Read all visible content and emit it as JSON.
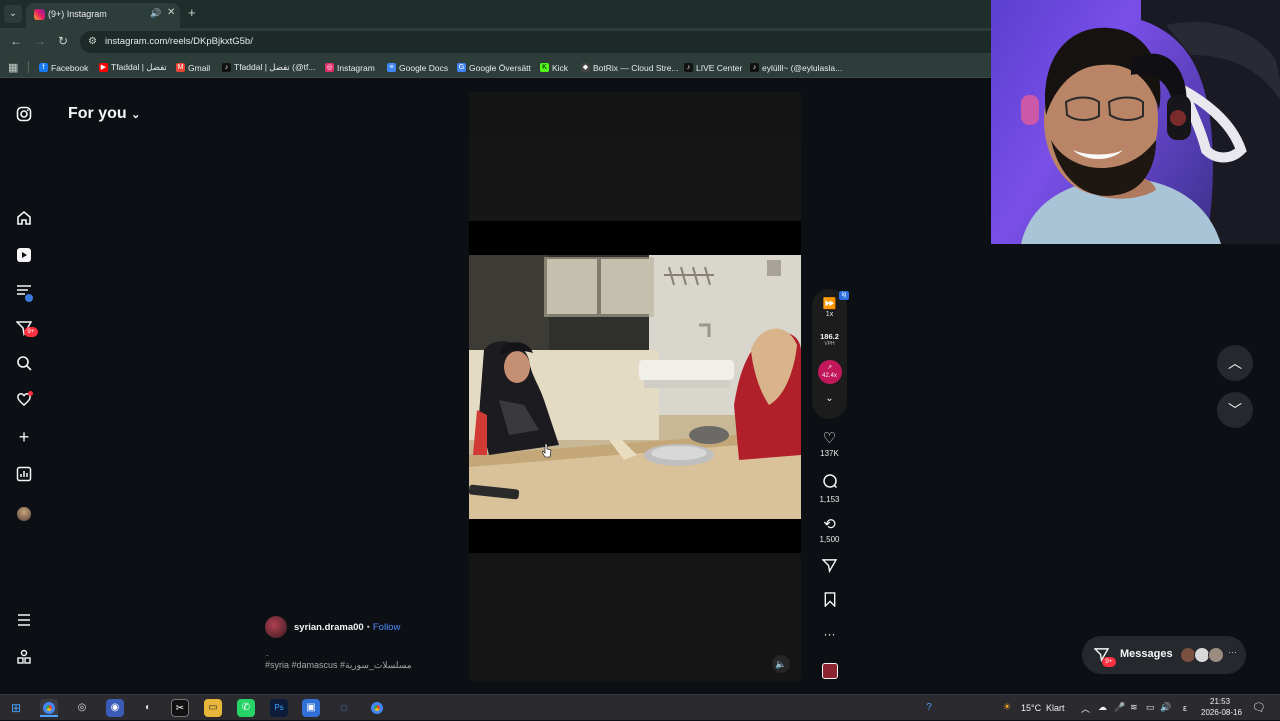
{
  "browser": {
    "tab_title": "(9+) Instagram",
    "url": "instagram.com/reels/DKpBjkxtG5b/",
    "bookmarks": [
      {
        "label": "Facebook",
        "color": "#1877f2",
        "glyph": "f"
      },
      {
        "label": "Tfaddal | تفضل",
        "color": "#ff0000",
        "glyph": "▶"
      },
      {
        "label": "Gmail",
        "color": "#ea4335",
        "glyph": "M"
      },
      {
        "label": "Tfaddal | تفضل (@tf...",
        "color": "#111111",
        "glyph": "♪"
      },
      {
        "label": "Instagram",
        "color": "#e1306c",
        "glyph": "◎"
      },
      {
        "label": "Google Docs",
        "color": "#4285f4",
        "glyph": "≡"
      },
      {
        "label": "Google Översätt",
        "color": "#4285f4",
        "glyph": "G"
      },
      {
        "label": "Kick",
        "color": "#53fc18",
        "glyph": "K"
      },
      {
        "label": "BotRix — Cloud Stre...",
        "color": "#444444",
        "glyph": "◆"
      },
      {
        "label": "LIVE Center",
        "color": "#111111",
        "glyph": "♪"
      },
      {
        "label": "eylülll~ (@eylulasla...",
        "color": "#111111",
        "glyph": "♪"
      }
    ]
  },
  "instagram": {
    "feed_title": "For you",
    "notifications_badge": "9+",
    "author": {
      "username": "syrian.drama00",
      "separator": "•",
      "follow_label": "Follow"
    },
    "caption_dot": ".",
    "caption": "#syria #damascus #مسلسلات_سورية",
    "extension": {
      "badge": "ig",
      "speed": "1x",
      "vph_value": "186.2",
      "vph_label": "VPH",
      "trend_value": "42.4x"
    },
    "actions": {
      "likes": "137K",
      "comments": "1,153",
      "reposts": "1,500"
    },
    "messages": {
      "label": "Messages",
      "badge": "9+"
    }
  },
  "taskbar": {
    "temperature": "15°C",
    "weather": "Klart",
    "language": "ε",
    "time": "21:53",
    "date": "2026-08-16"
  },
  "colors": {
    "ig_background": "#0c1014",
    "accent_blue": "#4f8cff",
    "notification_red": "#ff3040",
    "browser_chrome": "#2d3d39"
  }
}
